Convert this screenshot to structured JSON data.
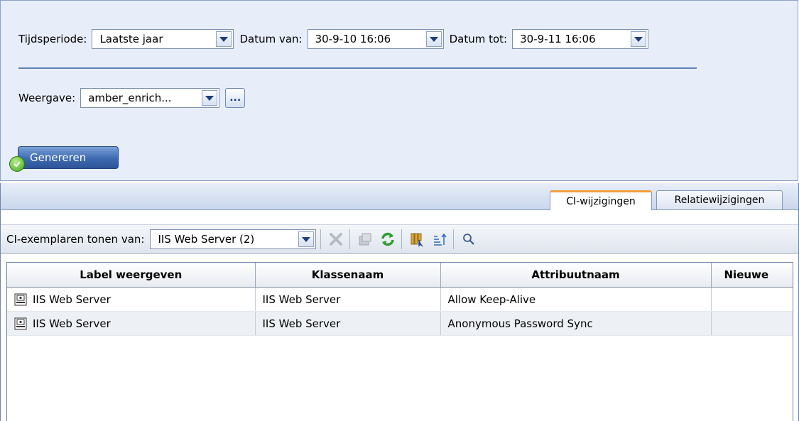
{
  "filter": {
    "tijdsperiode_label": "Tijdsperiode:",
    "tijdsperiode_value": "Laatste jaar",
    "datum_van_label": "Datum van:",
    "datum_van_value": "30-9-10 16:06",
    "datum_tot_label": "Datum tot:",
    "datum_tot_value": "30-9-11 16:06",
    "weergave_label": "Weergave:",
    "weergave_value": "amber_enrich...",
    "more_label": "...",
    "generate_label": "Genereren"
  },
  "tabs": [
    {
      "label": "CI-wijzigingen",
      "active": true
    },
    {
      "label": "Relatiewijzigingen",
      "active": false
    }
  ],
  "toolbar": {
    "ci_label": "CI-exemplaren tonen van:",
    "ci_value": "IIS Web Server (2)",
    "icons": [
      "delete-icon",
      "properties-icon",
      "refresh-icon",
      "select-columns-icon",
      "sort-icon",
      "search-icon"
    ]
  },
  "table": {
    "columns": [
      "Label weergeven",
      "Klassenaam",
      "Attribuutnaam",
      "Nieuwe"
    ],
    "rows": [
      [
        "IIS Web Server",
        "IIS Web Server",
        "Allow Keep-Alive",
        ""
      ],
      [
        "IIS Web Server",
        "IIS Web Server",
        "Anonymous Password Sync",
        ""
      ]
    ]
  },
  "colors": {
    "panel_bg": "#e7eef9",
    "accent_blue": "#3d69b0",
    "active_tab": "#f0a03a",
    "refresh_green": "#2e9e2e"
  }
}
